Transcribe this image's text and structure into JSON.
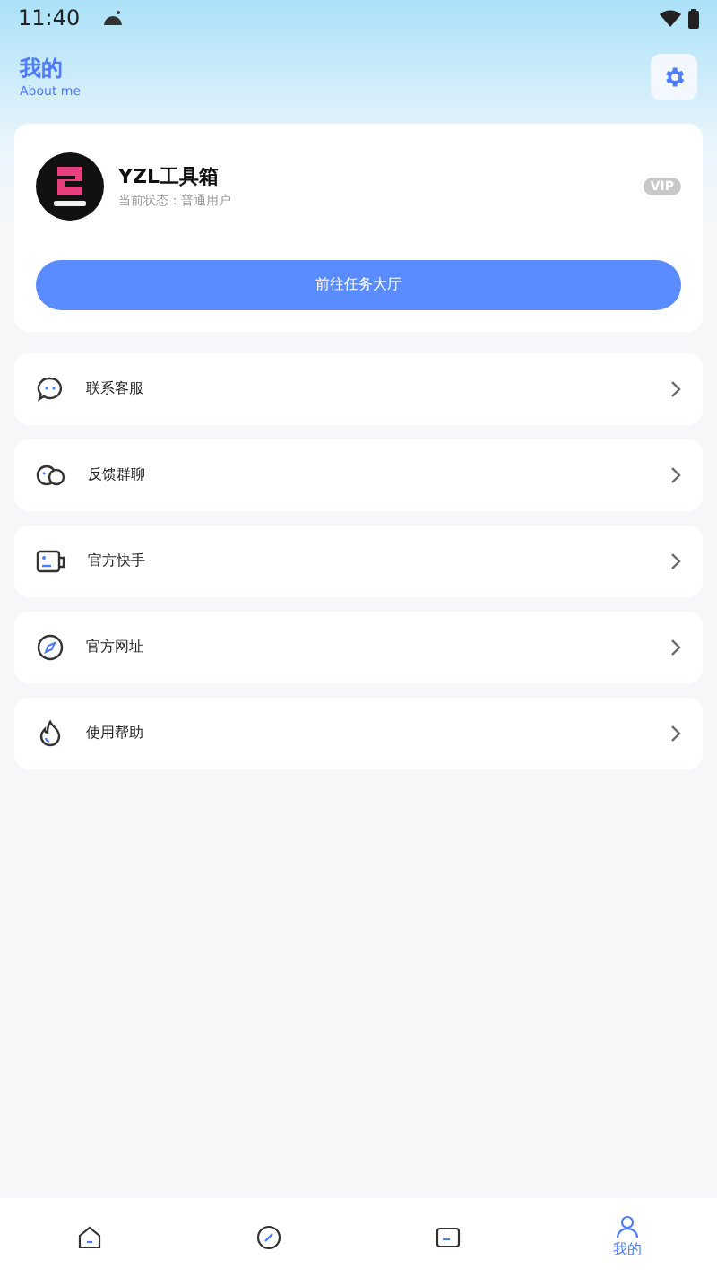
{
  "status_bar": {
    "time": "11:40"
  },
  "header": {
    "title": "我的",
    "subtitle": "About me"
  },
  "profile": {
    "name": "YZL工具箱",
    "status": "当前状态：普通用户",
    "badge": "VIP",
    "button": "前往任务大厅"
  },
  "menu": [
    {
      "kind": "chat",
      "label": "联系客服"
    },
    {
      "kind": "group",
      "label": "反馈群聊"
    },
    {
      "kind": "card",
      "label": "官方快手"
    },
    {
      "kind": "compass",
      "label": "官方网址"
    },
    {
      "kind": "flame",
      "label": "使用帮助"
    }
  ],
  "bottom_nav": [
    {
      "kind": "home",
      "selected": false
    },
    {
      "kind": "compass",
      "selected": false
    },
    {
      "kind": "card",
      "selected": false
    },
    {
      "kind": "me",
      "label": "我的",
      "selected": true
    }
  ]
}
